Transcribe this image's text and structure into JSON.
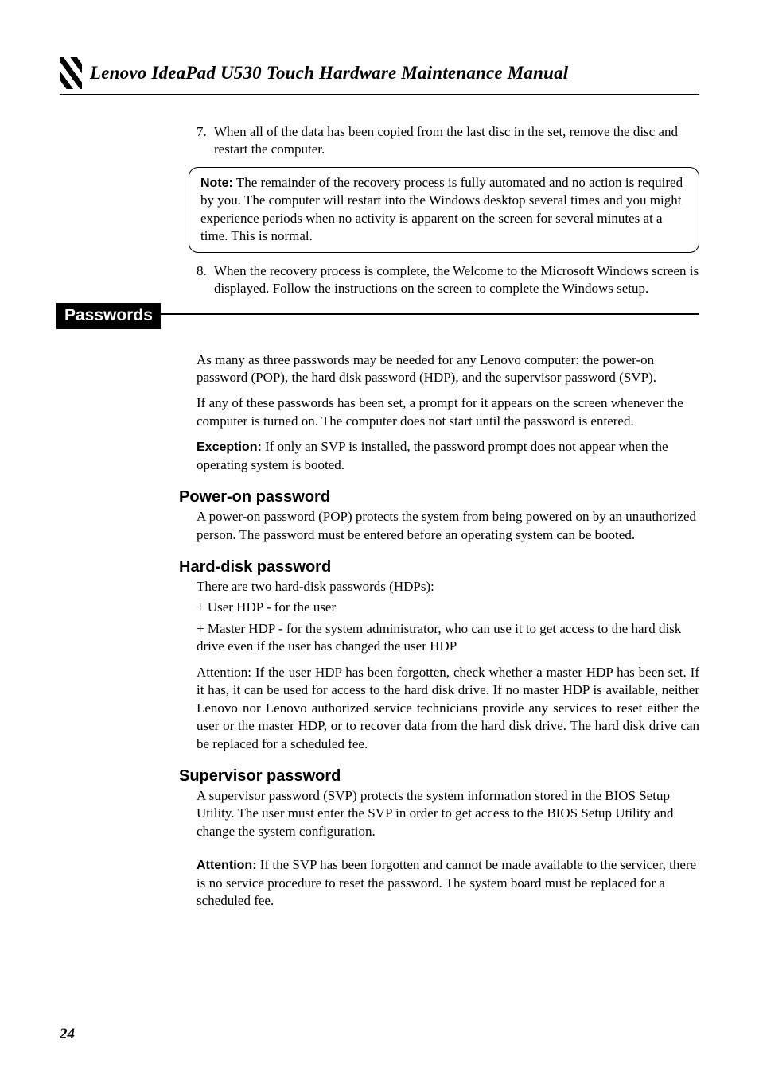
{
  "header": {
    "title": "Lenovo IdeaPad U530 Touch Hardware Maintenance Manual"
  },
  "top_list": {
    "item7_num": "7.",
    "item7_text": "When all of the data has been copied from the last disc in the set, remove the disc and restart the computer.",
    "note_label": "Note:",
    "note_text": " The remainder of the recovery process is fully automated and no action is required by you. The computer will restart into the Windows desktop several times and you might experience periods when no activity is apparent on the screen for several minutes at a time. This is normal.",
    "item8_num": "8.",
    "item8_text": "When the recovery process is complete, the Welcome to the Microsoft Windows screen is displayed. Follow the instructions on the screen to complete the Windows setup."
  },
  "section": {
    "title": "Passwords",
    "intro1": "As many as three passwords may be needed for any Lenovo computer: the power-on password (POP), the hard disk password (HDP), and the supervisor password (SVP).",
    "intro2": "If any of these passwords has been set, a prompt for it appears on the screen whenever the computer is turned on. The computer does not start until the password is entered.",
    "exception_label": "Exception:",
    "exception_text": " If only an SVP is installed, the password prompt does not appear when the operating system is booted."
  },
  "sub1": {
    "heading": "Power-on password",
    "body": "A power-on password (POP) protects the system from being powered on by an unauthorized person. The password must be entered before an operating system can be booted."
  },
  "sub2": {
    "heading": "Hard-disk password",
    "line1": "There are two hard-disk passwords (HDPs):",
    "bullet1": "+ User HDP - for the user",
    "bullet2": "+ Master HDP - for the system administrator, who can use it to get access to the hard disk drive even if the user has changed the user HDP",
    "attn": "Attention: If the user HDP has been forgotten, check whether a master HDP has been set. If it has, it can be used for access to the hard disk drive. If no master HDP is available, neither Lenovo nor Lenovo authorized service technicians provide any services to reset either the user or the master HDP, or to recover data from the hard disk drive. The hard disk drive can be replaced for a scheduled fee."
  },
  "sub3": {
    "heading": "Supervisor password",
    "body1": "A supervisor password (SVP) protects the system information stored in the BIOS Setup Utility. The user must enter the SVP in order to get access to the BIOS Setup Utility and change the system configuration.",
    "attn_label": "Attention:",
    "attn_text": " If the SVP has been forgotten and cannot be made available to the servicer, there is no service procedure to reset the password. The system board must be replaced for a scheduled fee."
  },
  "page_number": "24"
}
